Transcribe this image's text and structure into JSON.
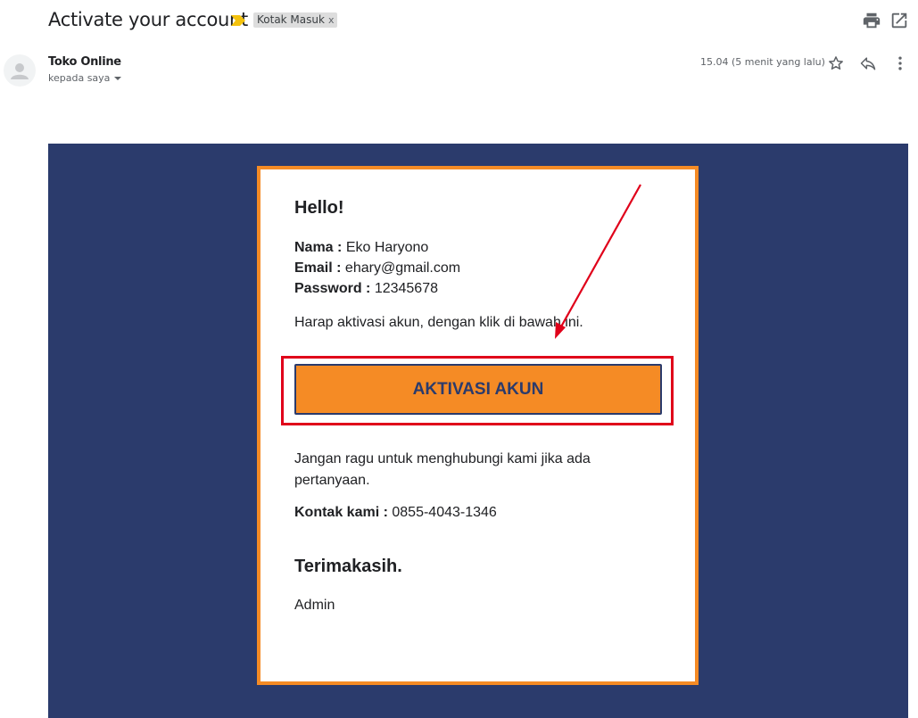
{
  "header": {
    "subject": "Activate your account",
    "label": "Kotak Masuk",
    "label_remove": "x",
    "icons": [
      "print-icon",
      "open-in-new-window-icon"
    ]
  },
  "message": {
    "sender": "Toko Online",
    "to": "kepada saya",
    "time": "15.04 (5 menit yang lalu)",
    "icons": [
      "star-icon",
      "reply-icon",
      "more-vert-icon"
    ]
  },
  "email": {
    "greeting": "Hello!",
    "fields": [
      {
        "label": "Nama :",
        "value": "Eko Haryono"
      },
      {
        "label": "Email :",
        "value": "ehary@gmail.com"
      },
      {
        "label": "Password :",
        "value": "12345678"
      }
    ],
    "instruction": "Harap aktivasi akun, dengan klik di bawah ini.",
    "button_label": "AKTIVASI AKUN",
    "contact_note": "Jangan ragu untuk menghubungi kami jika ada pertanyaan.",
    "contact_label": "Kontak kami :",
    "contact_value": "0855-4043-1346",
    "thanks": "Terimakasih.",
    "signature": "Admin"
  },
  "colors": {
    "email_background": "#2b3b6c",
    "card_border": "#f58b25",
    "button_fill": "#f58b25",
    "annotation": "#e0001a"
  }
}
